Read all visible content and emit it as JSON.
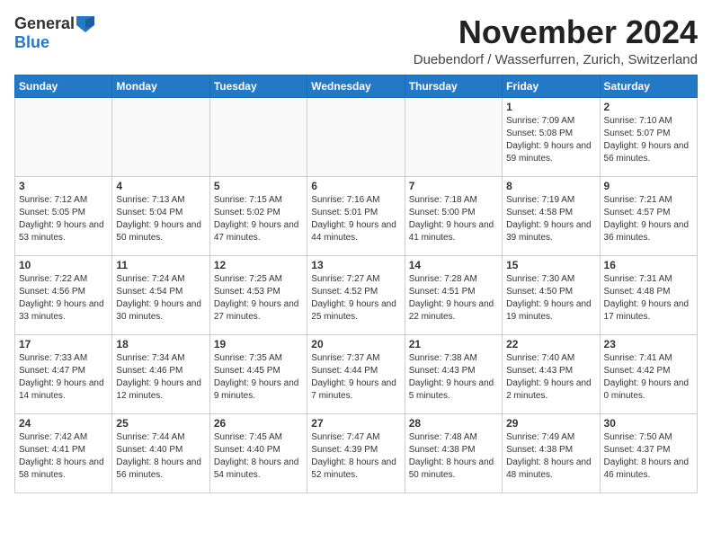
{
  "logo": {
    "general": "General",
    "blue": "Blue"
  },
  "header": {
    "month_title": "November 2024",
    "location": "Duebendorf / Wasserfurren, Zurich, Switzerland"
  },
  "days_of_week": [
    "Sunday",
    "Monday",
    "Tuesday",
    "Wednesday",
    "Thursday",
    "Friday",
    "Saturday"
  ],
  "weeks": [
    [
      {
        "day": "",
        "info": ""
      },
      {
        "day": "",
        "info": ""
      },
      {
        "day": "",
        "info": ""
      },
      {
        "day": "",
        "info": ""
      },
      {
        "day": "",
        "info": ""
      },
      {
        "day": "1",
        "info": "Sunrise: 7:09 AM\nSunset: 5:08 PM\nDaylight: 9 hours and 59 minutes."
      },
      {
        "day": "2",
        "info": "Sunrise: 7:10 AM\nSunset: 5:07 PM\nDaylight: 9 hours and 56 minutes."
      }
    ],
    [
      {
        "day": "3",
        "info": "Sunrise: 7:12 AM\nSunset: 5:05 PM\nDaylight: 9 hours and 53 minutes."
      },
      {
        "day": "4",
        "info": "Sunrise: 7:13 AM\nSunset: 5:04 PM\nDaylight: 9 hours and 50 minutes."
      },
      {
        "day": "5",
        "info": "Sunrise: 7:15 AM\nSunset: 5:02 PM\nDaylight: 9 hours and 47 minutes."
      },
      {
        "day": "6",
        "info": "Sunrise: 7:16 AM\nSunset: 5:01 PM\nDaylight: 9 hours and 44 minutes."
      },
      {
        "day": "7",
        "info": "Sunrise: 7:18 AM\nSunset: 5:00 PM\nDaylight: 9 hours and 41 minutes."
      },
      {
        "day": "8",
        "info": "Sunrise: 7:19 AM\nSunset: 4:58 PM\nDaylight: 9 hours and 39 minutes."
      },
      {
        "day": "9",
        "info": "Sunrise: 7:21 AM\nSunset: 4:57 PM\nDaylight: 9 hours and 36 minutes."
      }
    ],
    [
      {
        "day": "10",
        "info": "Sunrise: 7:22 AM\nSunset: 4:56 PM\nDaylight: 9 hours and 33 minutes."
      },
      {
        "day": "11",
        "info": "Sunrise: 7:24 AM\nSunset: 4:54 PM\nDaylight: 9 hours and 30 minutes."
      },
      {
        "day": "12",
        "info": "Sunrise: 7:25 AM\nSunset: 4:53 PM\nDaylight: 9 hours and 27 minutes."
      },
      {
        "day": "13",
        "info": "Sunrise: 7:27 AM\nSunset: 4:52 PM\nDaylight: 9 hours and 25 minutes."
      },
      {
        "day": "14",
        "info": "Sunrise: 7:28 AM\nSunset: 4:51 PM\nDaylight: 9 hours and 22 minutes."
      },
      {
        "day": "15",
        "info": "Sunrise: 7:30 AM\nSunset: 4:50 PM\nDaylight: 9 hours and 19 minutes."
      },
      {
        "day": "16",
        "info": "Sunrise: 7:31 AM\nSunset: 4:48 PM\nDaylight: 9 hours and 17 minutes."
      }
    ],
    [
      {
        "day": "17",
        "info": "Sunrise: 7:33 AM\nSunset: 4:47 PM\nDaylight: 9 hours and 14 minutes."
      },
      {
        "day": "18",
        "info": "Sunrise: 7:34 AM\nSunset: 4:46 PM\nDaylight: 9 hours and 12 minutes."
      },
      {
        "day": "19",
        "info": "Sunrise: 7:35 AM\nSunset: 4:45 PM\nDaylight: 9 hours and 9 minutes."
      },
      {
        "day": "20",
        "info": "Sunrise: 7:37 AM\nSunset: 4:44 PM\nDaylight: 9 hours and 7 minutes."
      },
      {
        "day": "21",
        "info": "Sunrise: 7:38 AM\nSunset: 4:43 PM\nDaylight: 9 hours and 5 minutes."
      },
      {
        "day": "22",
        "info": "Sunrise: 7:40 AM\nSunset: 4:43 PM\nDaylight: 9 hours and 2 minutes."
      },
      {
        "day": "23",
        "info": "Sunrise: 7:41 AM\nSunset: 4:42 PM\nDaylight: 9 hours and 0 minutes."
      }
    ],
    [
      {
        "day": "24",
        "info": "Sunrise: 7:42 AM\nSunset: 4:41 PM\nDaylight: 8 hours and 58 minutes."
      },
      {
        "day": "25",
        "info": "Sunrise: 7:44 AM\nSunset: 4:40 PM\nDaylight: 8 hours and 56 minutes."
      },
      {
        "day": "26",
        "info": "Sunrise: 7:45 AM\nSunset: 4:40 PM\nDaylight: 8 hours and 54 minutes."
      },
      {
        "day": "27",
        "info": "Sunrise: 7:47 AM\nSunset: 4:39 PM\nDaylight: 8 hours and 52 minutes."
      },
      {
        "day": "28",
        "info": "Sunrise: 7:48 AM\nSunset: 4:38 PM\nDaylight: 8 hours and 50 minutes."
      },
      {
        "day": "29",
        "info": "Sunrise: 7:49 AM\nSunset: 4:38 PM\nDaylight: 8 hours and 48 minutes."
      },
      {
        "day": "30",
        "info": "Sunrise: 7:50 AM\nSunset: 4:37 PM\nDaylight: 8 hours and 46 minutes."
      }
    ]
  ]
}
